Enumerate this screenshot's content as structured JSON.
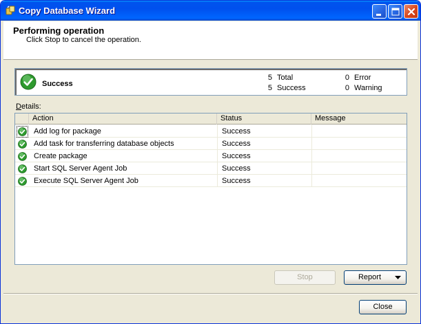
{
  "window": {
    "title": "Copy Database Wizard"
  },
  "header": {
    "title": "Performing operation",
    "subtitle": "Click Stop to cancel the operation."
  },
  "summary": {
    "status": "Success",
    "total_count": "5",
    "total_label": "Total",
    "success_count": "5",
    "success_label": "Success",
    "error_count": "0",
    "error_label": "Error",
    "warning_count": "0",
    "warning_label": "Warning"
  },
  "details": {
    "label": "Details:",
    "columns": [
      "Action",
      "Status",
      "Message"
    ],
    "rows": [
      {
        "action": "Add log for package",
        "status": "Success",
        "message": ""
      },
      {
        "action": "Add task for transferring database objects",
        "status": "Success",
        "message": ""
      },
      {
        "action": "Create package",
        "status": "Success",
        "message": ""
      },
      {
        "action": "Start SQL Server Agent Job",
        "status": "Success",
        "message": ""
      },
      {
        "action": "Execute SQL Server Agent Job",
        "status": "Success",
        "message": ""
      }
    ]
  },
  "buttons": {
    "stop": "Stop",
    "report": "Report",
    "close": "Close"
  },
  "colors": {
    "success_green": "#2e9a2e",
    "titlebar_blue": "#0054e3"
  }
}
